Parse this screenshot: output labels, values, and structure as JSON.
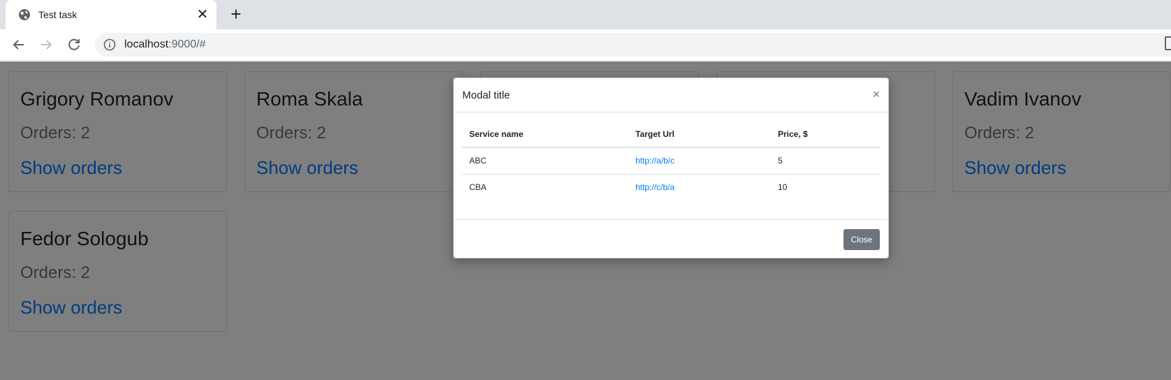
{
  "browser": {
    "tab_title": "Test task",
    "url_host": "localhost",
    "url_rest": ":9000/#"
  },
  "cards": [
    {
      "name": "Grigory Romanov",
      "orders": "Orders: 2",
      "link": "Show orders"
    },
    {
      "name": "Roma Skala",
      "orders": "Orders: 2",
      "link": "Show orders"
    },
    {
      "name": "",
      "orders": "",
      "link": ""
    },
    {
      "name": "",
      "orders": "",
      "link": ""
    },
    {
      "name": "Vadim Ivanov",
      "orders": "Orders: 2",
      "link": "Show orders"
    },
    {
      "name": "Fedor Sologub",
      "orders": "Orders: 2",
      "link": "Show orders"
    }
  ],
  "modal": {
    "title": "Modal title",
    "close_x": "×",
    "columns": [
      "Service name",
      "Target Url",
      "Price, $"
    ],
    "rows": [
      {
        "service": "ABC",
        "url": "http://a/b/c",
        "price": "5"
      },
      {
        "service": "CBA",
        "url": "http://c/b/a",
        "price": "10"
      }
    ],
    "close_label": "Close"
  },
  "colors": {
    "link": "#007bff",
    "secondary_button": "#6c757d",
    "backdrop": "rgba(0,0,0,0.5)"
  }
}
